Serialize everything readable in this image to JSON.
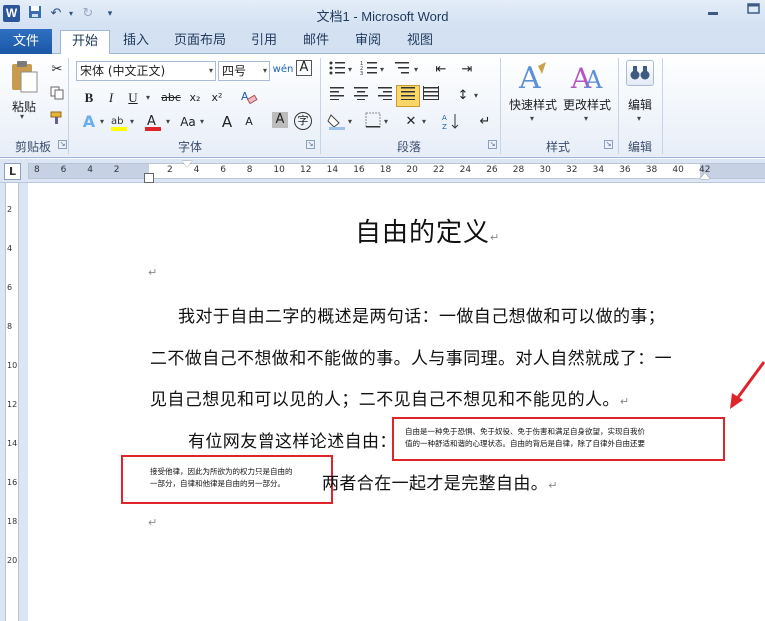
{
  "window": {
    "app_logo": "W",
    "title": "文档1 - Microsoft Word"
  },
  "tabs": {
    "file": "文件",
    "items": [
      "开始",
      "插入",
      "页面布局",
      "引用",
      "邮件",
      "审阅",
      "视图"
    ],
    "active": "开始"
  },
  "ribbon": {
    "clipboard": {
      "label": "剪贴板",
      "paste": "粘贴"
    },
    "font": {
      "label": "字体",
      "font_name": "宋体 (中文正文)",
      "font_size": "四号",
      "wen": "wén",
      "bold": "B",
      "italic": "I",
      "underline": "U",
      "strike": "abc",
      "sub": "x₂",
      "sup": "x²",
      "case": "Aa",
      "grow": "A",
      "shrink": "A",
      "char_border": "A",
      "phonetic": "字"
    },
    "paragraph": {
      "label": "段落"
    },
    "styles": {
      "label": "样式",
      "quick_styles": "快速样式",
      "change_styles": "更改样式"
    },
    "editing": {
      "label": "编辑",
      "edit": "编辑"
    }
  },
  "ruler": {
    "numbers": [
      "8",
      "6",
      "4",
      "2",
      "",
      "2",
      "4",
      "6",
      "8",
      "10",
      "12",
      "14",
      "16",
      "18",
      "20",
      "22",
      "24",
      "26",
      "28",
      "30",
      "32",
      "34",
      "36",
      "38",
      "40",
      "42"
    ],
    "tab_selector": "L"
  },
  "vertical_ruler": {
    "numbers": [
      "2",
      "4",
      "6",
      "8",
      "10",
      "12",
      "14",
      "16",
      "18",
      "20"
    ]
  },
  "document": {
    "title": "自由的定义",
    "para_mark": "↵",
    "p1_line1": "我对于自由二字的概述是两句话：一做自己想做和可以做的事；",
    "p1_line2": "二不做自己不想做和不能做的事。人与事同理。对人自然就成了：一",
    "p1_line3": "见自己想见和可以见的人；二不见自己不想见和不能见的人。",
    "p2_start": "有位网友曾这样论述自由：",
    "p2_end": "两者合在一起才是完整自由。",
    "box1_line1": "自由是一种免于恐惧、免于奴役、免于伤害和满足自身欲望，实现自我价",
    "box1_line2": "值的一种舒适和谐的心理状态。自由的背后是自律，除了自律外自由还要",
    "box2_line1": "接受他律，因此为所欲为的权力只是自由的",
    "box2_line2": "一部分，自律和他律是自由的另一部分。"
  },
  "colors": {
    "file_tab": "#1c57a8",
    "annotation_red": "#e0242b",
    "ribbon_bg": "#e7eef8"
  }
}
